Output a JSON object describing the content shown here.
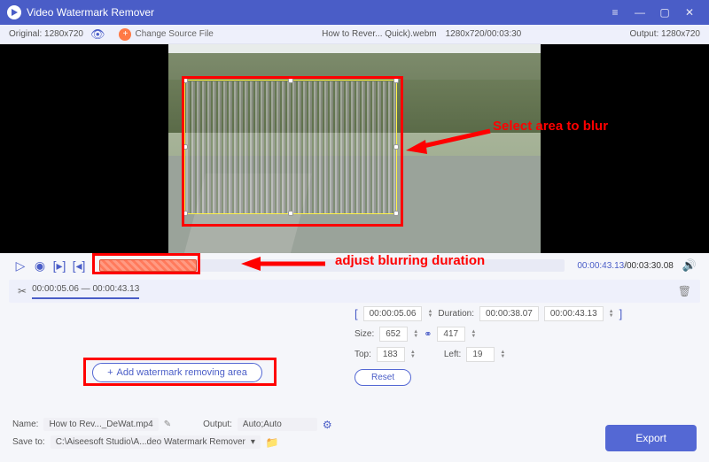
{
  "app": {
    "title": "Video Watermark Remover"
  },
  "infobar": {
    "original": "Original: 1280x720",
    "change_label": "Change Source File",
    "filename": "How to Rever... Quick).webm",
    "dims_time": "1280x720/00:03:30",
    "output": "Output: 1280x720"
  },
  "annotations": {
    "select_area": "Select area to blur",
    "adjust_duration": "adjust blurring duration"
  },
  "controls": {
    "current_time": "00:00:43.13",
    "total_time": "00:03:30.08"
  },
  "segment": {
    "range": "00:00:05.06 — 00:00:43.13"
  },
  "params": {
    "start_label": "",
    "start": "00:00:05.06",
    "duration_label": "Duration:",
    "duration": "00:00:38.07",
    "end": "00:00:43.13",
    "size_label": "Size:",
    "size_w": "652",
    "size_h": "417",
    "top_label": "Top:",
    "top": "183",
    "left_label": "Left:",
    "left": "19",
    "reset": "Reset"
  },
  "add_btn": "Add watermark removing area",
  "bottom": {
    "name_label": "Name:",
    "name_val": "How to Rev..._DeWat.mp4",
    "output_label": "Output:",
    "output_val": "Auto;Auto",
    "save_label": "Save to:",
    "save_val": "C:\\Aiseesoft Studio\\A...deo Watermark Remover",
    "export": "Export"
  }
}
